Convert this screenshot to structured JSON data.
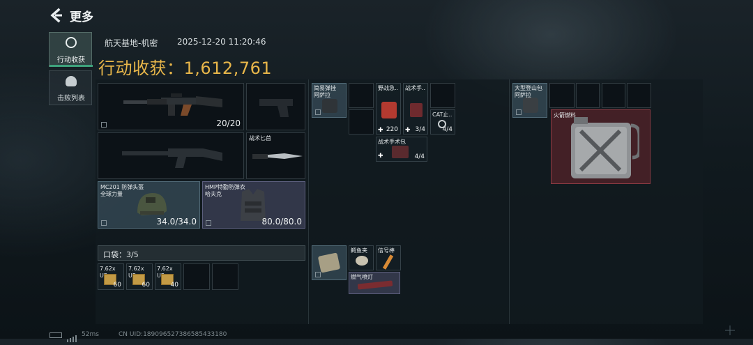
{
  "header": {
    "back_label": "更多"
  },
  "left_tabs": [
    {
      "label": "行动收获",
      "active": true
    },
    {
      "label": "击败列表",
      "active": false
    }
  ],
  "info": {
    "map_name": "航天基地-机密",
    "datetime": "2025-12-20 11:20:46",
    "total_title": "行动收获：1,612,761"
  },
  "equipment": {
    "primary_weapon": {
      "ammo": "20/20"
    },
    "knife": {
      "label": "战术匕首"
    },
    "helmet": {
      "label": "MC201 防弹头盔\n全球力量",
      "durability": "34.0/34.0"
    },
    "armor": {
      "label": "HMP特勤防弹衣\n哈夫克",
      "durability": "80.0/80.0"
    }
  },
  "pockets": {
    "title": "口袋：3/5",
    "items": [
      {
        "label": "7.62x\nUP",
        "qty": "60"
      },
      {
        "label": "7.62x\nUP",
        "qty": "60"
      },
      {
        "label": "7.62x\nUP",
        "qty": "40"
      }
    ]
  },
  "rig": {
    "first": {
      "label": "简易弹挂\n阿萨拉"
    },
    "field_kit": {
      "label": "野战急..",
      "qty": "220"
    },
    "tactical_med": {
      "label": "战术手..",
      "qty": "3/4"
    },
    "cat": {
      "label": "CAT止..",
      "qty": "4/4"
    },
    "surgery_kit": {
      "label": "战术手术包",
      "qty": "4/4"
    }
  },
  "bottom_middle": {
    "item_a": {
      "label": ""
    },
    "item_b": {
      "label": "鳄鱼夹"
    },
    "item_c": {
      "label": "信号棒"
    },
    "item_d": {
      "label": "燃气喷灯"
    }
  },
  "backpack": {
    "title": "大型登山包\n阿萨拉",
    "fuel": {
      "label": "火箭燃料"
    }
  },
  "status_bar": {
    "ping": "52ms",
    "uid": "CN UID:189096527386585433180"
  },
  "colors": {
    "accent": "#e8b64a",
    "active_tab": "#3ea27c"
  }
}
